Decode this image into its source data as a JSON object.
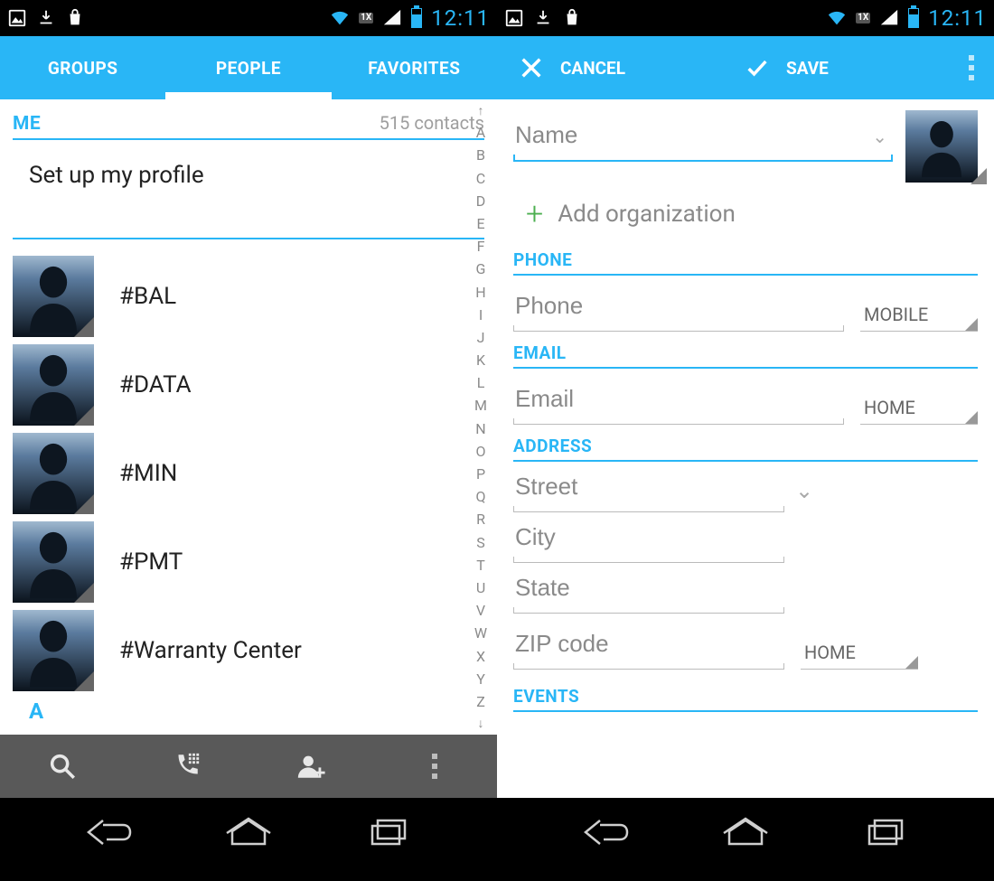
{
  "statusbar": {
    "time": "12:11",
    "net_label": "1X"
  },
  "left": {
    "tabs": {
      "groups": "GROUPS",
      "people": "PEOPLE",
      "favorites": "FAVORITES"
    },
    "me_label": "ME",
    "contact_count": "515 contacts",
    "profile_setup": "Set up my profile",
    "contacts": [
      {
        "name": "#BAL"
      },
      {
        "name": "#DATA"
      },
      {
        "name": "#MIN"
      },
      {
        "name": "#PMT"
      },
      {
        "name": "#Warranty Center"
      }
    ],
    "next_section_letter": "A",
    "index": [
      "A",
      "B",
      "C",
      "D",
      "E",
      "F",
      "G",
      "H",
      "I",
      "J",
      "K",
      "L",
      "M",
      "N",
      "O",
      "P",
      "Q",
      "R",
      "S",
      "T",
      "U",
      "V",
      "W",
      "X",
      "Y",
      "Z"
    ]
  },
  "right": {
    "actions": {
      "cancel": "CANCEL",
      "save": "SAVE"
    },
    "name_placeholder": "Name",
    "add_org": "Add organization",
    "sections": {
      "phone": "PHONE",
      "email": "EMAIL",
      "address": "ADDRESS",
      "events": "EVENTS"
    },
    "fields": {
      "phone_placeholder": "Phone",
      "phone_type": "MOBILE",
      "email_placeholder": "Email",
      "email_type": "HOME",
      "street_placeholder": "Street",
      "city_placeholder": "City",
      "state_placeholder": "State",
      "zip_placeholder": "ZIP code",
      "address_type": "HOME"
    }
  }
}
